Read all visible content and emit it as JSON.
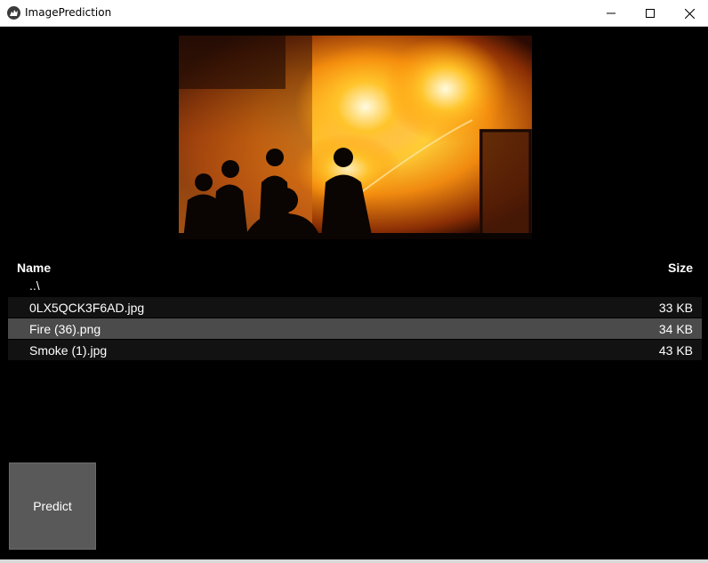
{
  "window": {
    "title": "ImagePrediction",
    "icons": {
      "app": "kivy-logo-icon",
      "minimize": "minimize-icon",
      "maximize": "maximize-icon",
      "close": "close-icon"
    }
  },
  "preview": {
    "description_icon": "fire-photo-image"
  },
  "file_browser": {
    "columns": {
      "name": "Name",
      "size": "Size"
    },
    "parent": "..\\",
    "files": [
      {
        "name": "0LX5QCK3F6AD.jpg",
        "size": "33 KB",
        "selected": false
      },
      {
        "name": "Fire (36).png",
        "size": "34 KB",
        "selected": true
      },
      {
        "name": "Smoke (1).jpg",
        "size": "43 KB",
        "selected": false
      }
    ]
  },
  "actions": {
    "predict_label": "Predict"
  },
  "colors": {
    "background": "#000000",
    "selected_row": "#4b4b4b",
    "row": "#121212",
    "button": "#595959"
  }
}
